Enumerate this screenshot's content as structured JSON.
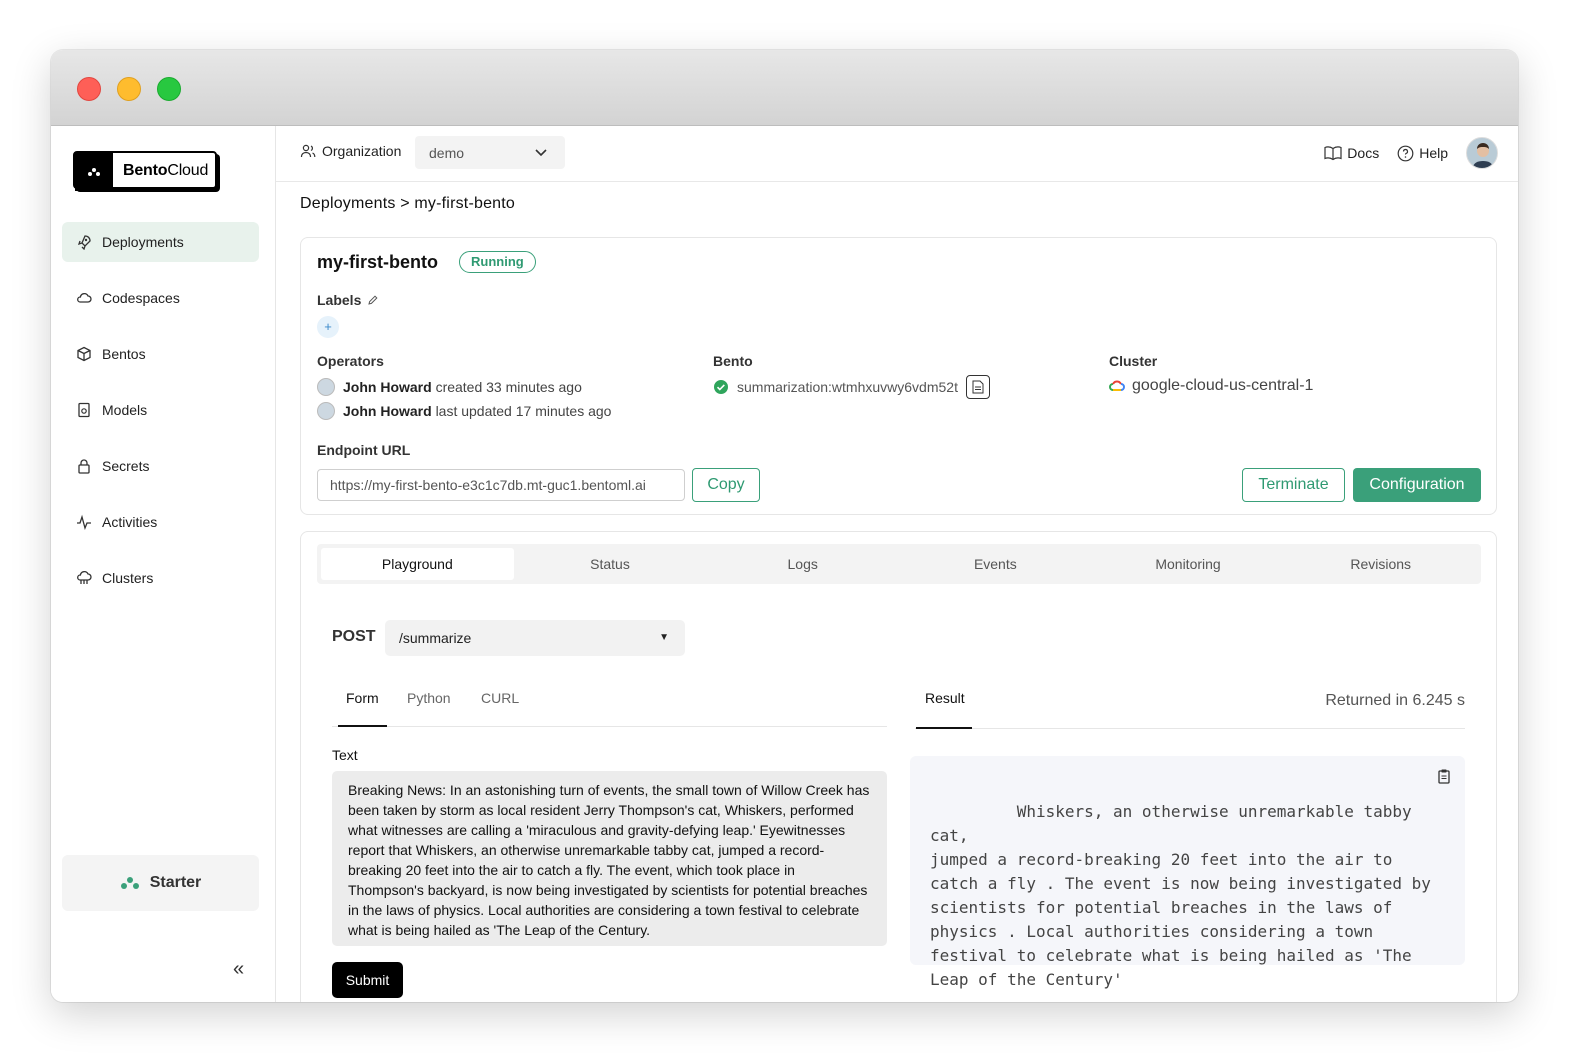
{
  "window": {
    "traffic_lights": [
      "close",
      "minimize",
      "maximize"
    ]
  },
  "sidebar": {
    "brand_bold": "Bento",
    "brand_rest": "Cloud",
    "items": [
      {
        "label": "Deployments",
        "icon": "rocket-icon",
        "active": true
      },
      {
        "label": "Codespaces",
        "icon": "cloud-code-icon",
        "active": false
      },
      {
        "label": "Bentos",
        "icon": "box-icon",
        "active": false
      },
      {
        "label": "Models",
        "icon": "model-icon",
        "active": false
      },
      {
        "label": "Secrets",
        "icon": "lock-icon",
        "active": false
      },
      {
        "label": "Activities",
        "icon": "activity-icon",
        "active": false
      },
      {
        "label": "Clusters",
        "icon": "cluster-icon",
        "active": false
      }
    ],
    "plan_label": "Starter",
    "collapse_glyph": "«"
  },
  "topbar": {
    "org_label": "Organization",
    "org_value": "demo",
    "docs_label": "Docs",
    "help_label": "Help"
  },
  "breadcrumb": "Deployments > my-first-bento",
  "deployment": {
    "name": "my-first-bento",
    "status": "Running",
    "labels_title": "Labels",
    "add_label": "+",
    "operators_title": "Operators",
    "operators": [
      {
        "name": "John Howard",
        "action": "created 33 minutes ago"
      },
      {
        "name": "John Howard",
        "action": "last updated 17 minutes ago"
      }
    ],
    "bento_title": "Bento",
    "bento_value": "summarization:wtmhxuvwy6vdm52t",
    "cluster_title": "Cluster",
    "cluster_value": "google-cloud-us-central-1",
    "endpoint_title": "Endpoint URL",
    "endpoint_url": "https://my-first-bento-e3c1c7db.mt-guc1.bentoml.ai",
    "copy_label": "Copy",
    "terminate_label": "Terminate",
    "configuration_label": "Configuration"
  },
  "tabs": [
    "Playground",
    "Status",
    "Logs",
    "Events",
    "Monitoring",
    "Revisions"
  ],
  "playground": {
    "method": "POST",
    "endpoint": "/summarize",
    "subtabs": [
      "Form",
      "Python",
      "CURL"
    ],
    "result_tab": "Result",
    "returned": "Returned in 6.245 s",
    "text_label": "Text",
    "input_text": "Breaking News: In an astonishing turn of events, the small town of Willow Creek has been taken by storm as local resident Jerry Thompson's cat, Whiskers, performed what witnesses are calling a 'miraculous and gravity-defying leap.' Eyewitnesses report that Whiskers, an otherwise unremarkable tabby cat, jumped a record-breaking 20 feet into the air to catch a fly. The event, which took place in Thompson's backyard, is now being investigated by scientists for potential breaches in the laws of physics. Local authorities are considering a town festival to celebrate what is being hailed as 'The Leap of the Century.",
    "submit_label": "Submit",
    "result_text": " Whiskers, an otherwise unremarkable tabby cat,\njumped a record-breaking 20 feet into the air to\ncatch a fly . The event is now being investigated by\nscientists for potential breaches in the laws of\nphysics . Local authorities considering a town\nfestival to celebrate what is being hailed as 'The\nLeap of the Century'"
  },
  "colors": {
    "accent": "#3aa07a",
    "active_nav_bg": "#e8f2ec",
    "result_bg": "#f5f6fa"
  }
}
